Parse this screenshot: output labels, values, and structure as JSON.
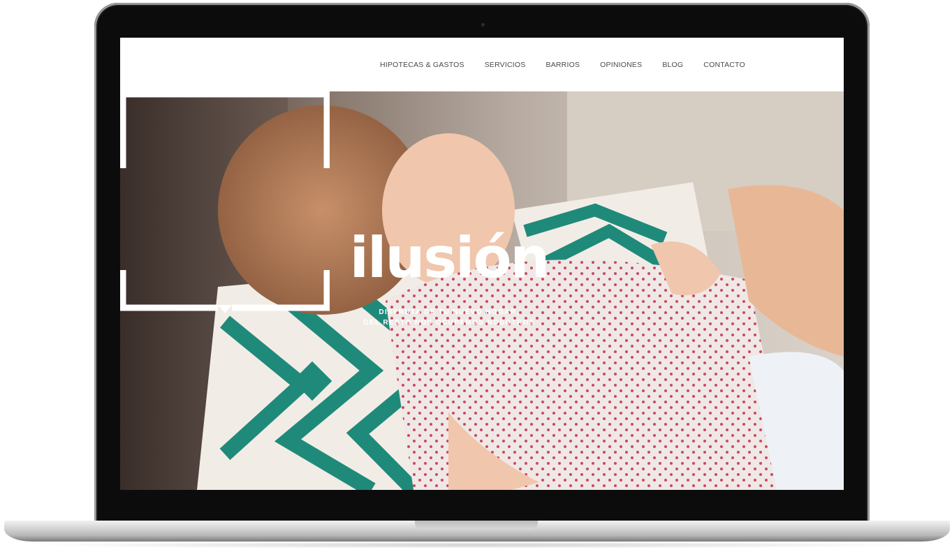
{
  "nav": {
    "items": [
      "HIPOTECAS & GASTOS",
      "SERVICIOS",
      "BARRIOS",
      "OPINIONES",
      "BLOG",
      "CONTACTO"
    ]
  },
  "hero": {
    "headline": "ilusión",
    "tagline_line1": "DISFRUTA DE TU NUEVO HOGAR,",
    "tagline_line2": "DEL RESTO NOS OCUPAMOS NOSOTROS",
    "image": "photo of a smiling toddler lying on a teal-and-white patterned pillow"
  },
  "colors": {
    "accent_teal": "#1f8a7a",
    "frame": "#ffffff",
    "nav_text": "#4a4a4a"
  }
}
